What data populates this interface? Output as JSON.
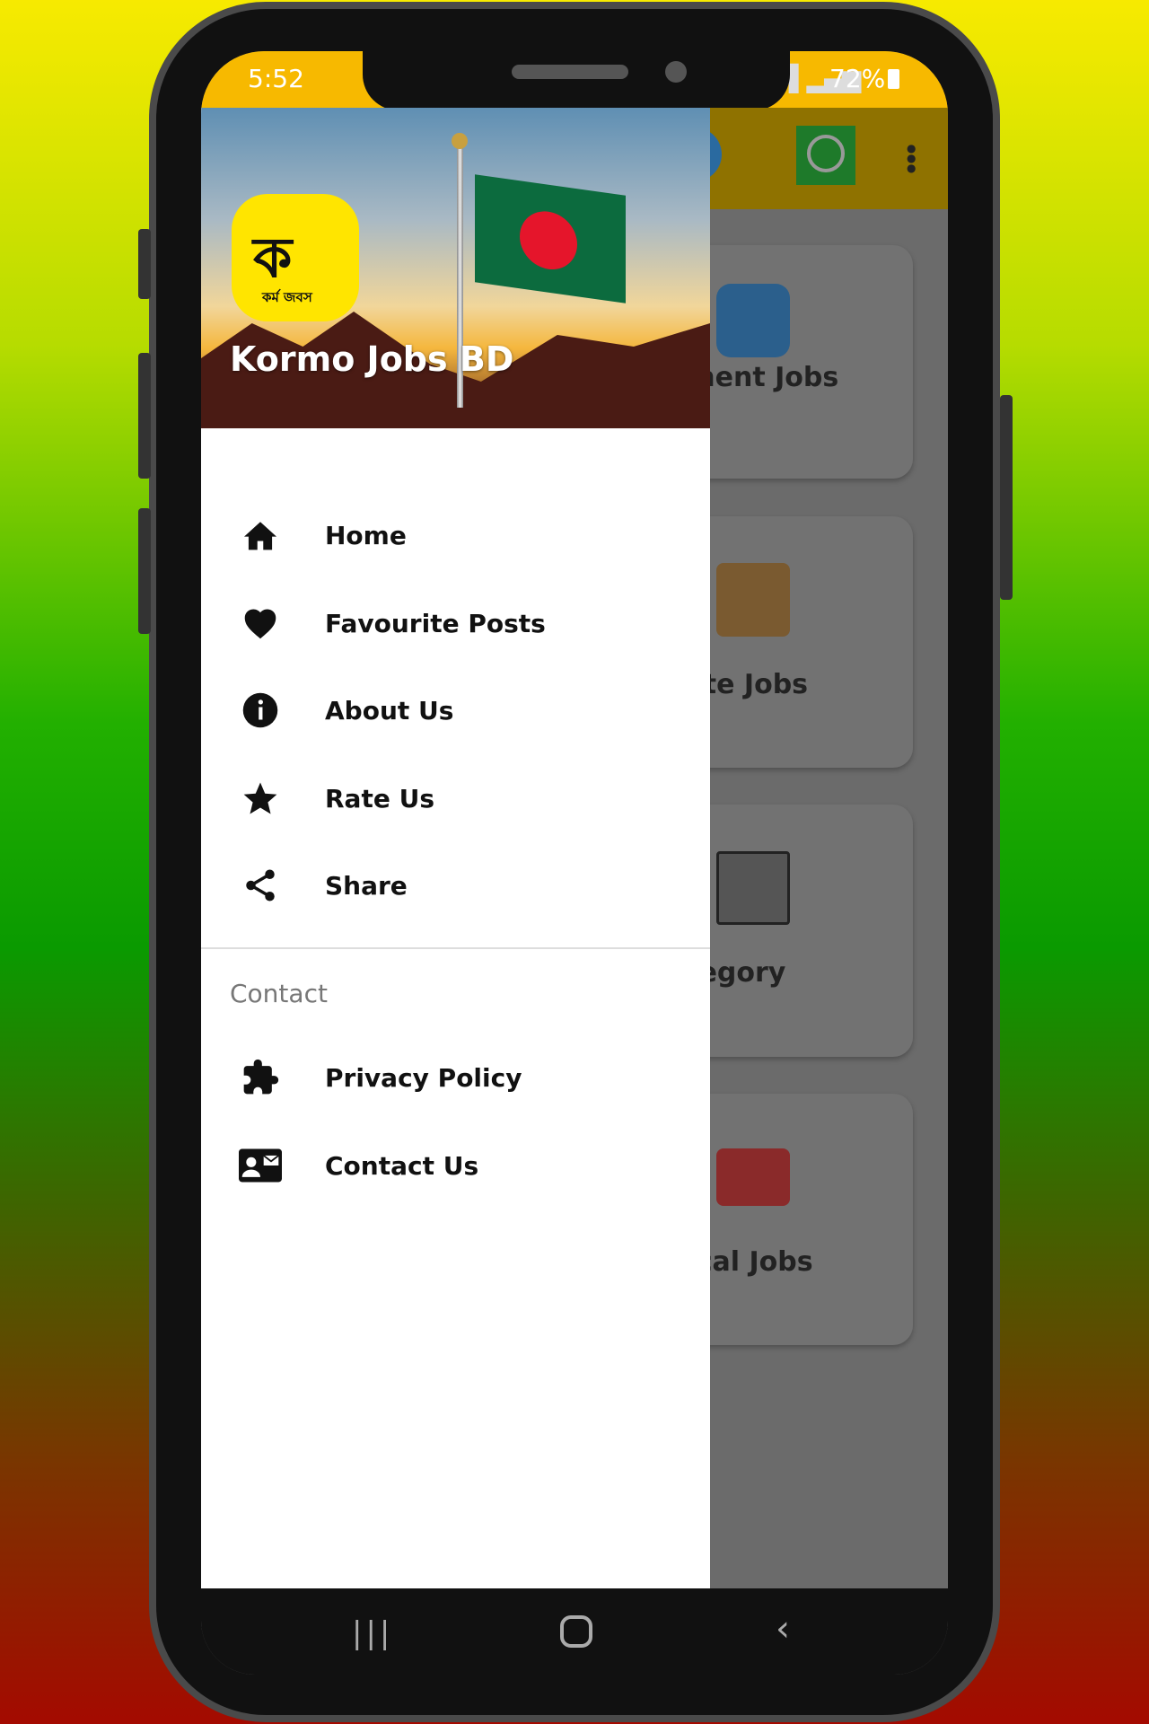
{
  "status_bar": {
    "time": "5:52",
    "battery": "72%"
  },
  "toolbar": {
    "icons": [
      "telegram-icon",
      "whatsapp-icon",
      "more-vert-icon"
    ]
  },
  "background_cards": [
    {
      "label": "nment Jobs",
      "icon": "graduate-icon"
    },
    {
      "label": "vate Jobs",
      "icon": "businessman-icon"
    },
    {
      "label": "ategory",
      "icon": "category-grid-icon"
    },
    {
      "label": "dical Jobs",
      "icon": "first-aid-kit-icon"
    }
  ],
  "drawer": {
    "app_title": "Kormo Jobs BD",
    "logo_text": "কর্ম জবস",
    "items": [
      {
        "label": "Home",
        "icon": "home-icon"
      },
      {
        "label": "Favourite Posts",
        "icon": "heart-icon"
      },
      {
        "label": "About Us",
        "icon": "info-icon"
      },
      {
        "label": "Rate Us",
        "icon": "star-icon"
      },
      {
        "label": "Share",
        "icon": "share-icon"
      }
    ],
    "section_title": "Contact",
    "contact_items": [
      {
        "label": "Privacy Policy",
        "icon": "puzzle-icon"
      },
      {
        "label": "Contact Us",
        "icon": "contact-card-icon"
      }
    ]
  },
  "colors": {
    "status_bar": "#f7b900",
    "accent": "#ffe500"
  }
}
